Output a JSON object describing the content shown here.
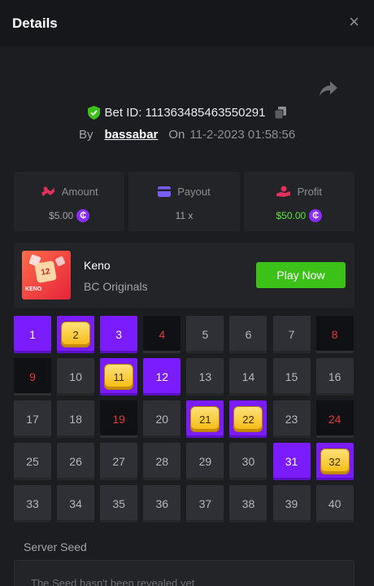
{
  "header": {
    "title": "Details",
    "close": "×"
  },
  "bet": {
    "label": "Bet ID: 111363485463550291",
    "by_label": "By",
    "user": "bassabar",
    "on_label": "On",
    "date": "11-2-2023 01:58:56"
  },
  "stats": {
    "amount_label": "Amount",
    "amount_value": "$5.00",
    "payout_label": "Payout",
    "payout_value": "11 x",
    "profit_label": "Profit",
    "profit_value": "$50.00"
  },
  "game": {
    "name": "Keno",
    "provider": "BC Originals",
    "thumb_number": "12",
    "thumb_label": "KENO",
    "play_label": "Play Now"
  },
  "keno": {
    "cells": [
      {
        "n": "1",
        "s": "pick"
      },
      {
        "n": "2",
        "s": "hit"
      },
      {
        "n": "3",
        "s": "pick"
      },
      {
        "n": "4",
        "s": "miss"
      },
      {
        "n": "5",
        "s": ""
      },
      {
        "n": "6",
        "s": ""
      },
      {
        "n": "7",
        "s": ""
      },
      {
        "n": "8",
        "s": "miss"
      },
      {
        "n": "9",
        "s": "miss"
      },
      {
        "n": "10",
        "s": ""
      },
      {
        "n": "11",
        "s": "hit"
      },
      {
        "n": "12",
        "s": "pick"
      },
      {
        "n": "13",
        "s": ""
      },
      {
        "n": "14",
        "s": ""
      },
      {
        "n": "15",
        "s": ""
      },
      {
        "n": "16",
        "s": ""
      },
      {
        "n": "17",
        "s": ""
      },
      {
        "n": "18",
        "s": ""
      },
      {
        "n": "19",
        "s": "miss"
      },
      {
        "n": "20",
        "s": ""
      },
      {
        "n": "21",
        "s": "hit"
      },
      {
        "n": "22",
        "s": "hit"
      },
      {
        "n": "23",
        "s": ""
      },
      {
        "n": "24",
        "s": "miss"
      },
      {
        "n": "25",
        "s": ""
      },
      {
        "n": "26",
        "s": ""
      },
      {
        "n": "27",
        "s": ""
      },
      {
        "n": "28",
        "s": ""
      },
      {
        "n": "29",
        "s": ""
      },
      {
        "n": "30",
        "s": ""
      },
      {
        "n": "31",
        "s": "pick"
      },
      {
        "n": "32",
        "s": "hit"
      },
      {
        "n": "33",
        "s": ""
      },
      {
        "n": "34",
        "s": ""
      },
      {
        "n": "35",
        "s": ""
      },
      {
        "n": "36",
        "s": ""
      },
      {
        "n": "37",
        "s": ""
      },
      {
        "n": "38",
        "s": ""
      },
      {
        "n": "39",
        "s": ""
      },
      {
        "n": "40",
        "s": ""
      }
    ]
  },
  "seed": {
    "label": "Server Seed",
    "value": "The Seed hasn't been revealed yet"
  },
  "colors": {
    "accent_purple": "#7a1cff",
    "play_green": "#3bc117",
    "profit_green": "#5ee43d",
    "miss_red": "#e03a3a"
  }
}
